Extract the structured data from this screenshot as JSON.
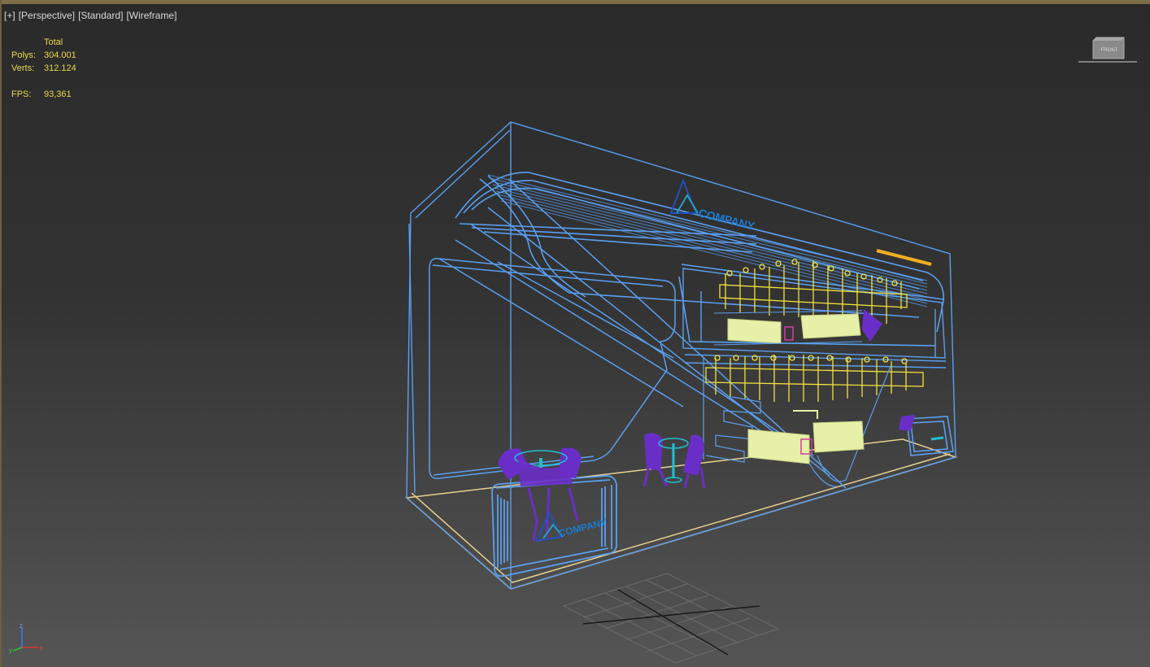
{
  "viewport": {
    "labels": {
      "plus": "[+]",
      "view": "[Perspective]",
      "shading": "[Standard]",
      "display": "[Wireframe]"
    }
  },
  "stats": {
    "header": "Total",
    "polys_label": "Polys:",
    "polys_value": "304.001",
    "verts_label": "Verts:",
    "verts_value": "312.124",
    "fps_label": "FPS:",
    "fps_value": "93,361"
  },
  "scene": {
    "logo_text_back": "COMPANY",
    "logo_text_front": "COMPANY"
  },
  "viewcube": {
    "label": "FRONT"
  },
  "axis": {
    "x": "x",
    "y": "y",
    "z": "z"
  },
  "colors": {
    "wire_blue": "#5a9ff0",
    "wire_yellow": "#f2e23c",
    "wire_pale": "#e6f0a8",
    "furniture_purple": "#6a2ec8",
    "cyan": "#20c0d0",
    "floor_outline": "#e8d090",
    "stats_text": "#e8d84a"
  }
}
